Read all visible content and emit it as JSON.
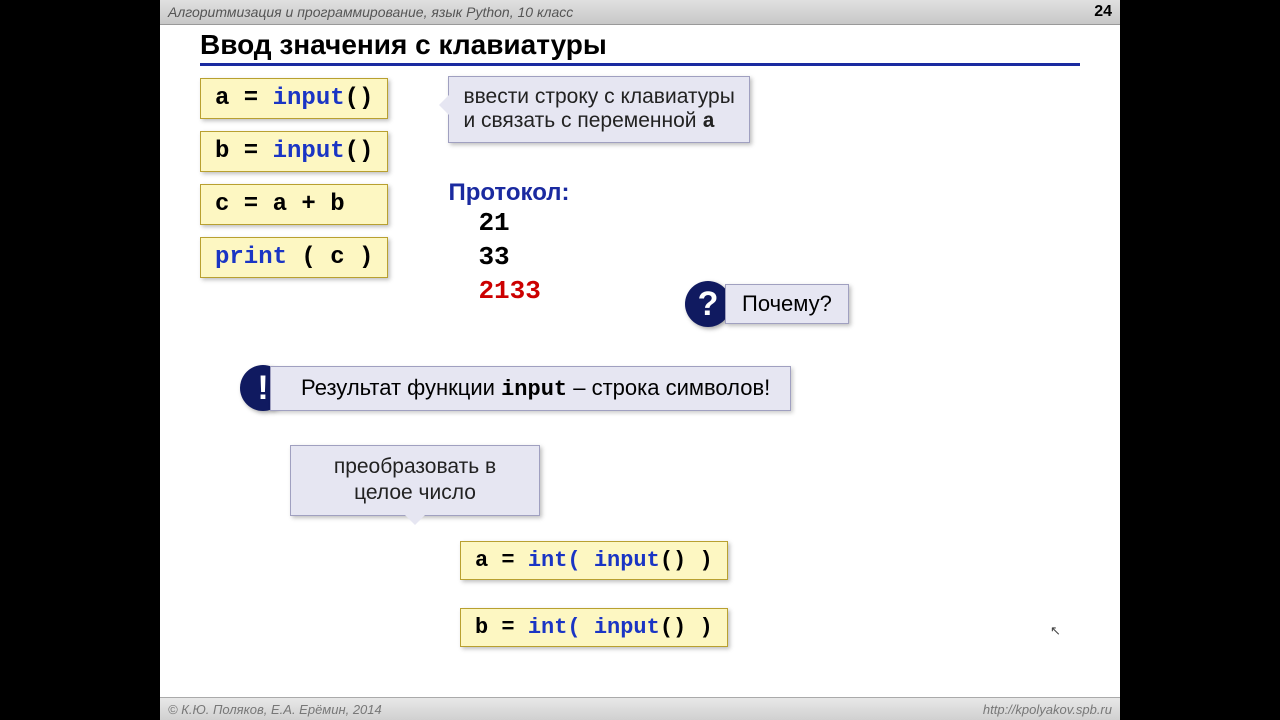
{
  "header": {
    "course": "Алгоритмизация и программирование, язык Python, 10 класс",
    "slide_number": "24"
  },
  "footer": {
    "copyright": "© К.Ю. Поляков, Е.А. Ерёмин, 2014",
    "url": "http://kpolyakov.spb.ru"
  },
  "title": "Ввод значения с клавиатуры",
  "code": {
    "a_input_pre": "a = ",
    "a_input_func": "input",
    "a_input_post": "()",
    "b_input_pre": "b = ",
    "c_sum": "c = a + b",
    "print_pre": "print",
    "print_post": " ( c )",
    "int_a_pre": "a = ",
    "int_a_mid": "int( ",
    "int_a_func": "input",
    "int_a_post": "() )",
    "int_b_pre": "b = "
  },
  "callouts": {
    "input_desc_line1": "ввести строку с клавиатуры",
    "input_desc_line2": "и связать с переменной ",
    "var_a": "a",
    "why": "Почему?",
    "result_pre": "Результат функции ",
    "result_func": "input",
    "result_post": " – строка символов!",
    "convert_line1": "преобразовать в",
    "convert_line2": "целое число"
  },
  "proto": {
    "label": "Протокол:",
    "v1": "21",
    "v2": "33",
    "v3": "2133"
  },
  "badges": {
    "question": "?",
    "exclaim": "!"
  }
}
